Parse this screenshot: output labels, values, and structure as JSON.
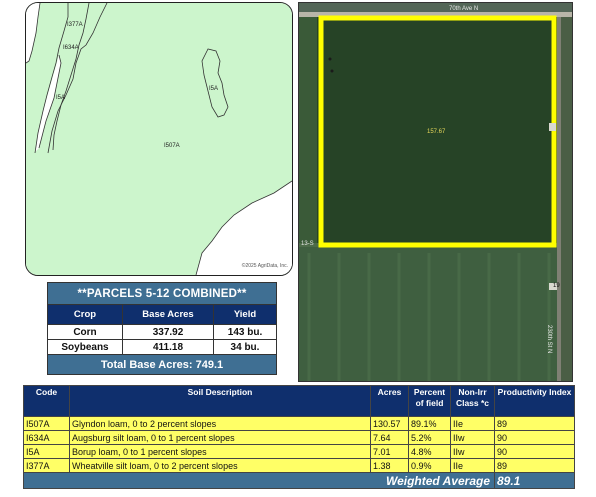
{
  "soil_map": {
    "labels": [
      "I377A",
      "I634A",
      "I5A",
      "I5A",
      "I507A"
    ],
    "copyright": "©2025 AgriData, Inc."
  },
  "aerial": {
    "field_acres": "157.67",
    "road_labels": [
      "70th Ave N",
      "13-S",
      "19",
      "230th St N"
    ]
  },
  "parcels": {
    "title": "**PARCELS 5-12 COMBINED**",
    "headers": [
      "Crop",
      "Base Acres",
      "Yield"
    ],
    "rows": [
      [
        "Corn",
        "337.92",
        "143 bu."
      ],
      [
        "Soybeans",
        "411.18",
        "34 bu."
      ]
    ],
    "total": "Total Base Acres:  749.1"
  },
  "soils": {
    "headers": [
      "Code",
      "Soil Description",
      "Acres",
      "Percent of field",
      "Non-Irr Class *c",
      "Productivity Index"
    ],
    "rows": [
      [
        "I507A",
        "Glyndon loam, 0 to 2 percent slopes",
        "130.57",
        "89.1%",
        "IIe",
        "89"
      ],
      [
        "I634A",
        "Augsburg silt loam, 0 to 1 percent slopes",
        "7.64",
        "5.2%",
        "IIw",
        "90"
      ],
      [
        "I5A",
        "Borup loam, 0 to 1 percent slopes",
        "7.01",
        "4.8%",
        "IIw",
        "90"
      ],
      [
        "I377A",
        "Wheatville silt loam, 0 to 2 percent slopes",
        "1.38",
        "0.9%",
        "IIe",
        "89"
      ]
    ],
    "weighted_average_label": "Weighted Average",
    "weighted_average_value": "89.1"
  },
  "colors": {
    "soil_fill": "#ccf5cc",
    "header_navy": "#0f2f6d",
    "header_steel": "#3f6f93",
    "row_yellow": "#ffff66",
    "boundary_yellow": "#ffff00"
  }
}
